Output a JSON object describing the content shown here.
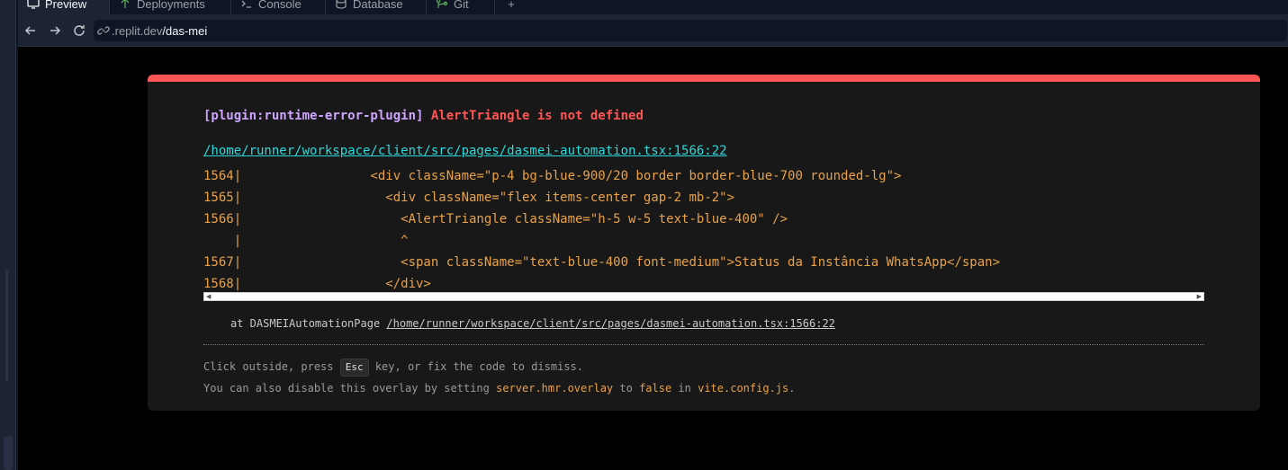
{
  "tabs": [
    {
      "label": "Preview",
      "icon": "monitor-icon",
      "active": true
    },
    {
      "label": "Deployments",
      "icon": "deploy-icon",
      "active": false
    },
    {
      "label": "Console",
      "icon": "terminal-icon",
      "active": false
    },
    {
      "label": "Database",
      "icon": "database-icon",
      "active": false
    },
    {
      "label": "Git",
      "icon": "git-branch-icon",
      "active": false
    },
    {
      "label": "+",
      "icon": "plus-icon",
      "active": false
    }
  ],
  "urlbar": {
    "domain": ".replit.dev",
    "path": "/das-mei"
  },
  "overlay": {
    "plugin": "[plugin:runtime-error-plugin]",
    "message": "AlertTriangle is not defined",
    "file": "/home/runner/workspace/client/src/pages/dasmei-automation.tsx:1566:22",
    "frame_lines": [
      "1564|                 <div className=\"p-4 bg-blue-900/20 border border-blue-700 rounded-lg\">",
      "1565|                   <div className=\"flex items-center gap-2 mb-2\">",
      "1566|                     <AlertTriangle className=\"h-5 w-5 text-blue-400\" />",
      "    |                     ^",
      "1567|                     <span className=\"text-blue-400 font-medium\">Status da Instância WhatsApp</span>",
      "1568|                   </div>"
    ],
    "stack_prefix": "at DASMEIAutomationPage ",
    "stack_file": "/home/runner/workspace/client/src/pages/dasmei-automation.tsx:1566:22",
    "tip1_before": "Click outside, press ",
    "tip1_key": "Esc",
    "tip1_after": " key, or fix the code to dismiss.",
    "tip2_a": "You can also disable this overlay by setting ",
    "tip2_b": "server.hmr.overlay",
    "tip2_c": " to ",
    "tip2_d": "false",
    "tip2_e": " in ",
    "tip2_f": "vite.config.js",
    "tip2_g": "."
  },
  "colors": {
    "accent_red": "#ff5555",
    "plugin_purple": "#cfa4ff",
    "file_cyan": "#2dd9da",
    "code_orange": "#e8a249"
  }
}
